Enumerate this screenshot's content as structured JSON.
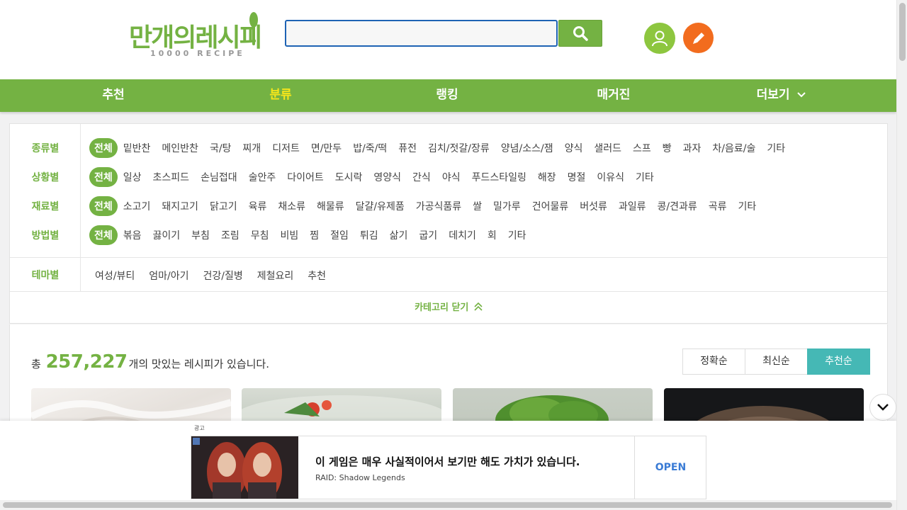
{
  "header": {
    "logo_text": "만개의레시피",
    "logo_sub": "10000 RECIPE",
    "search_placeholder": "",
    "search_icon": "search-icon",
    "user_icon": "user-icon",
    "write_icon": "pencil-icon"
  },
  "nav": {
    "items": [
      {
        "label": "추천",
        "active": false
      },
      {
        "label": "분류",
        "active": true
      },
      {
        "label": "랭킹",
        "active": false
      },
      {
        "label": "매거진",
        "active": false
      },
      {
        "label": "더보기",
        "active": false
      }
    ],
    "active_color": "#f7e61a",
    "bg_color": "#74b243"
  },
  "categories": {
    "rows": [
      {
        "label": "종류별",
        "items": [
          "전체",
          "밑반찬",
          "메인반찬",
          "국/탕",
          "찌개",
          "디저트",
          "면/만두",
          "밥/죽/떡",
          "퓨전",
          "김치/젓갈/장류",
          "양념/소스/잼",
          "양식",
          "샐러드",
          "스프",
          "빵",
          "과자",
          "차/음료/술",
          "기타"
        ]
      },
      {
        "label": "상황별",
        "items": [
          "전체",
          "일상",
          "초스피드",
          "손님접대",
          "술안주",
          "다이어트",
          "도시락",
          "영양식",
          "간식",
          "야식",
          "푸드스타일링",
          "해장",
          "명절",
          "이유식",
          "기타"
        ]
      },
      {
        "label": "재료별",
        "items": [
          "전체",
          "소고기",
          "돼지고기",
          "닭고기",
          "육류",
          "채소류",
          "해물류",
          "달걀/유제품",
          "가공식품류",
          "쌀",
          "밀가루",
          "건어물류",
          "버섯류",
          "과일류",
          "콩/견과류",
          "곡류",
          "기타"
        ]
      },
      {
        "label": "방법별",
        "items": [
          "전체",
          "볶음",
          "끓이기",
          "부침",
          "조림",
          "무침",
          "비빔",
          "찜",
          "절임",
          "튀김",
          "삶기",
          "굽기",
          "데치기",
          "회",
          "기타"
        ]
      }
    ],
    "theme": {
      "label": "테마별",
      "items": [
        "여성/뷰티",
        "엄마/아기",
        "건강/질병",
        "제철요리",
        "추천"
      ]
    },
    "close_label": "카테고리 닫기"
  },
  "results": {
    "total_prefix": "총",
    "total_count": "257,227",
    "total_suffix": "개의 맛있는 레시피가 있습니다.",
    "sort": [
      {
        "label": "정확순",
        "active": false
      },
      {
        "label": "최신순",
        "active": false
      },
      {
        "label": "추천순",
        "active": true
      }
    ]
  },
  "ad": {
    "label": "광고",
    "title": "이 게임은 매우 사실적이어서 보기만 해도 가치가 있습니다.",
    "sub": "RAID: Shadow Legends",
    "cta": "OPEN"
  }
}
